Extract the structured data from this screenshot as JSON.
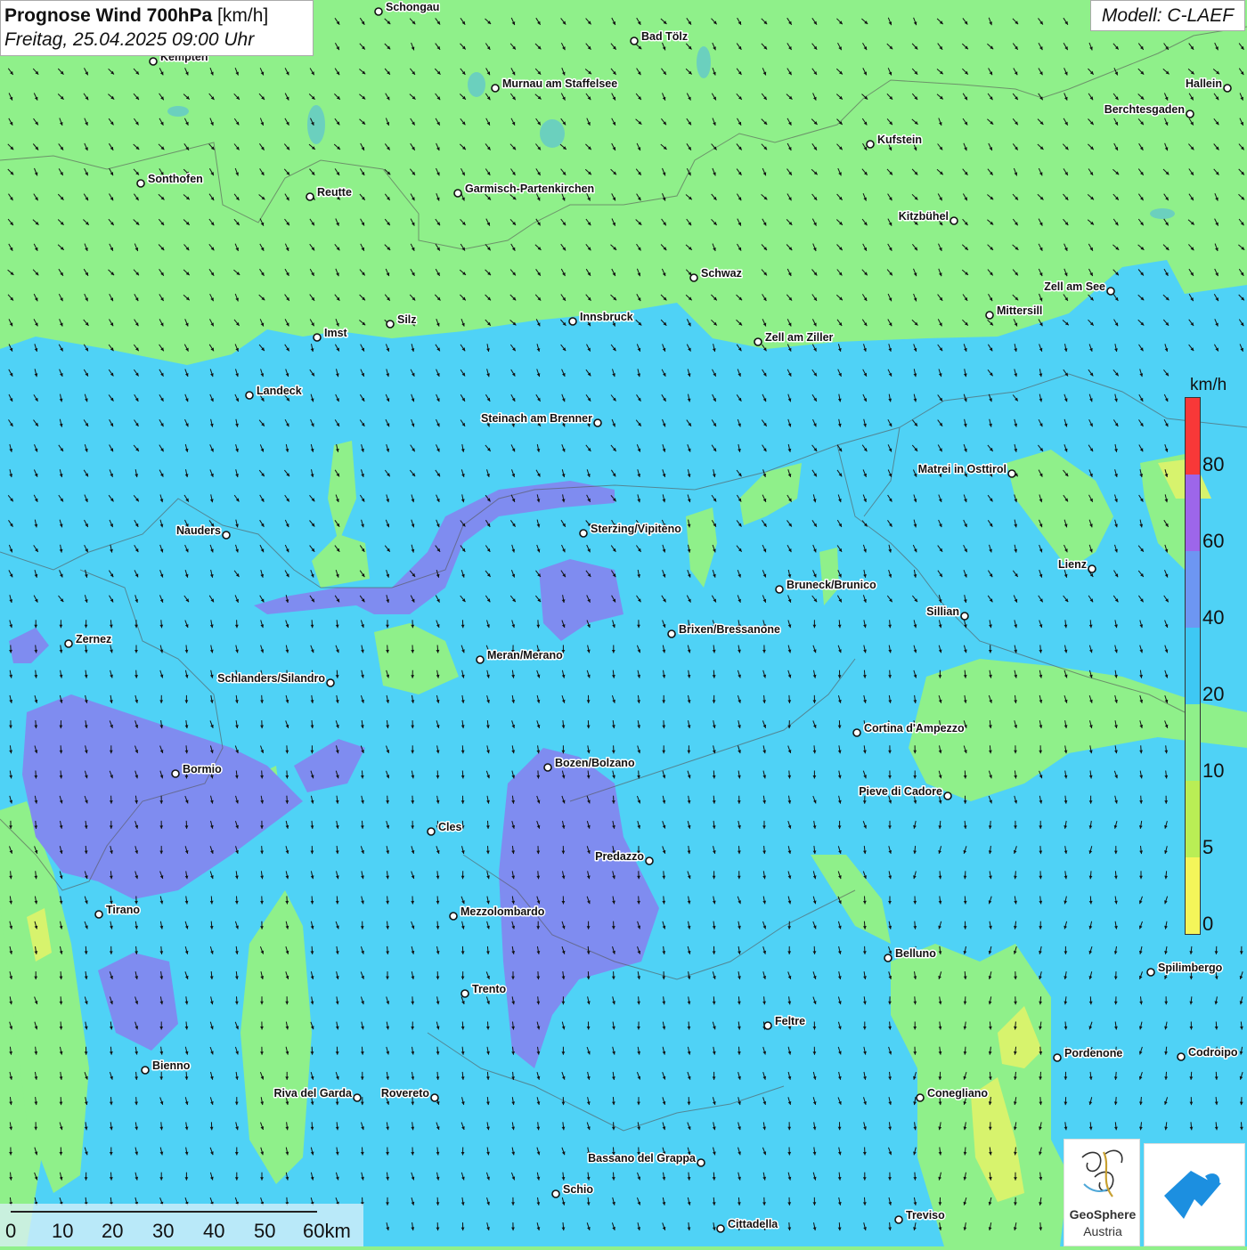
{
  "title": {
    "main": "Prognose Wind 700hPa",
    "unit": "[km/h]",
    "datetime": "Freitag, 25.04.2025 09:00 Uhr"
  },
  "model": "Modell: C-LAEF",
  "legend": {
    "unit": "km/h",
    "ticks": [
      "0",
      "5",
      "10",
      "20",
      "40",
      "60",
      "80"
    ],
    "colors": [
      "#f4f55a",
      "#b9ee55",
      "#8ff08a",
      "#3ec8f4",
      "#6d96f2",
      "#9d66ea",
      "#f83838"
    ]
  },
  "colors": {
    "low_wind": "#8ff08a",
    "mid_wind": "#4fd2f6",
    "high_wind": "#7f8cf0",
    "very_low_wind": "#d7f36d"
  },
  "scale": {
    "labels": [
      "0",
      "10",
      "20",
      "30",
      "40",
      "50",
      "60km"
    ]
  },
  "logos": {
    "geosphere_line1": "GeoSphere",
    "geosphere_line2": "Austria"
  },
  "cities": [
    {
      "name": "Schongau"
    },
    {
      "name": "Bad Tölz"
    },
    {
      "name": "Kempten"
    },
    {
      "name": "Murnau am Staffelsee"
    },
    {
      "name": "Hallein"
    },
    {
      "name": "Berchtesgaden"
    },
    {
      "name": "Kufstein"
    },
    {
      "name": "Sonthofen"
    },
    {
      "name": "Reutte"
    },
    {
      "name": "Garmisch-Partenkirchen"
    },
    {
      "name": "Kitzbühel"
    },
    {
      "name": "Schwaz"
    },
    {
      "name": "Zell am See"
    },
    {
      "name": "Mittersill"
    },
    {
      "name": "Innsbruck"
    },
    {
      "name": "Silz"
    },
    {
      "name": "Imst"
    },
    {
      "name": "Zell am Ziller"
    },
    {
      "name": "Landeck"
    },
    {
      "name": "Steinach am Brenner"
    },
    {
      "name": "Matrei in Osttirol"
    },
    {
      "name": "Nauders"
    },
    {
      "name": "Sterzing/Vipiteno"
    },
    {
      "name": "Lienz"
    },
    {
      "name": "Bruneck/Brunico"
    },
    {
      "name": "Sillian"
    },
    {
      "name": "Brixen/Bressanone"
    },
    {
      "name": "Zernez"
    },
    {
      "name": "Meran/Merano"
    },
    {
      "name": "Schlanders/Silandro"
    },
    {
      "name": "Cortina d'Ampezzo"
    },
    {
      "name": "Bozen/Bolzano"
    },
    {
      "name": "Bormio"
    },
    {
      "name": "Pieve di Cadore"
    },
    {
      "name": "Cles"
    },
    {
      "name": "Predazzo"
    },
    {
      "name": "Tirano"
    },
    {
      "name": "Mezzolombardo"
    },
    {
      "name": "Belluno"
    },
    {
      "name": "Spilimbergo"
    },
    {
      "name": "Trento"
    },
    {
      "name": "Feltre"
    },
    {
      "name": "Pordenone"
    },
    {
      "name": "Codroipo"
    },
    {
      "name": "Bienno"
    },
    {
      "name": "Riva del Garda"
    },
    {
      "name": "Rovereto"
    },
    {
      "name": "Conegliano"
    },
    {
      "name": "Bassano del Grappa"
    },
    {
      "name": "Schio"
    },
    {
      "name": "Treviso"
    },
    {
      "name": "Cittadella"
    }
  ]
}
